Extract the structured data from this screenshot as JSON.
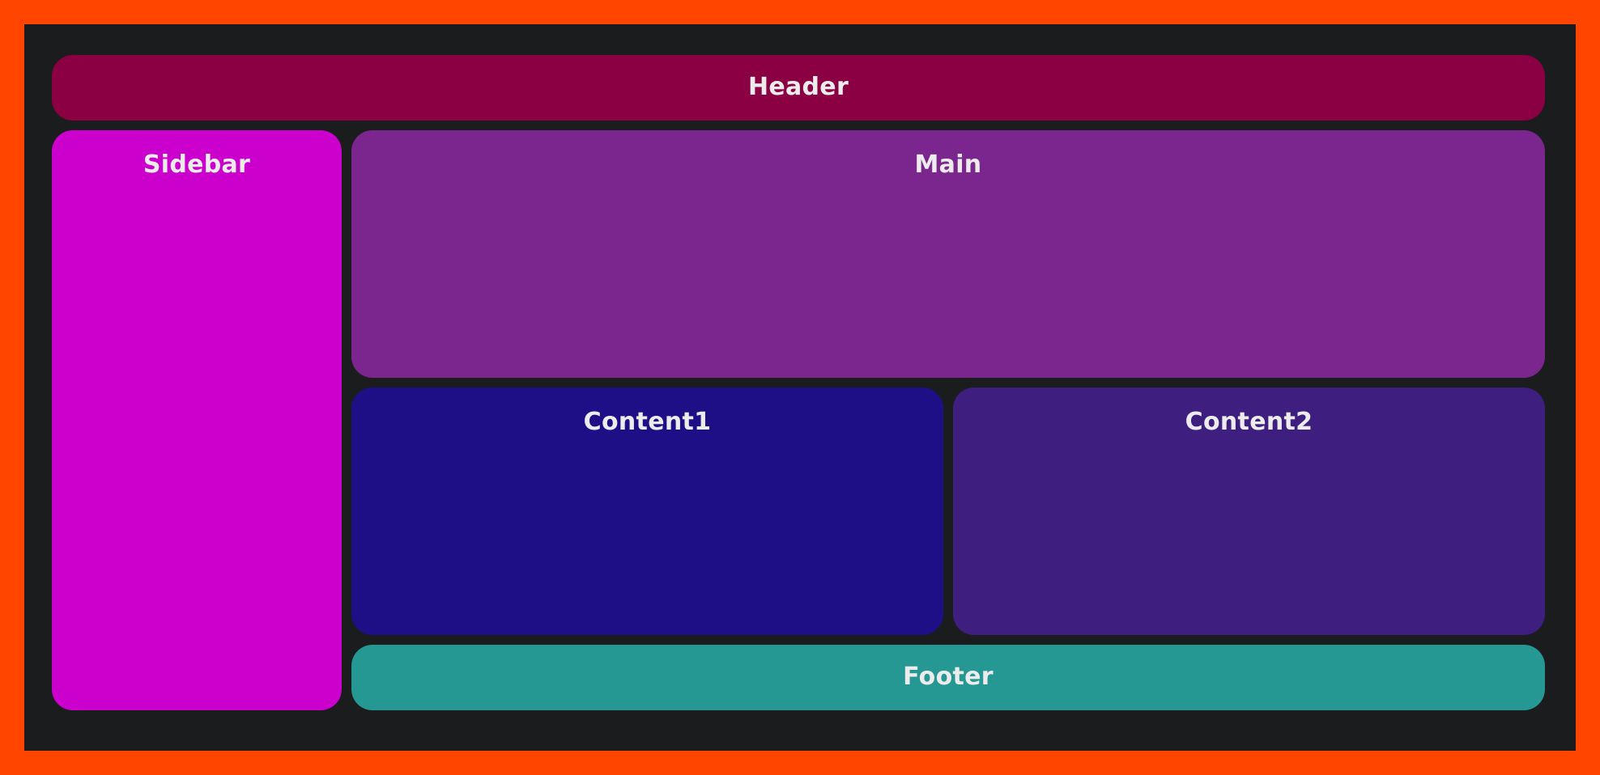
{
  "colors": {
    "outer_border": "#ff4500",
    "canvas_bg": "#1b1c1e",
    "header": "#8b0042",
    "sidebar": "#cc00cc",
    "main": "#7b268f",
    "content1": "#1f0f86",
    "content2": "#3e1f80",
    "footer": "#269894",
    "text": "#ececec"
  },
  "layout": {
    "header": {
      "label": "Header"
    },
    "sidebar": {
      "label": "Sidebar"
    },
    "main": {
      "label": "Main"
    },
    "content1": {
      "label": "Content1"
    },
    "content2": {
      "label": "Content2"
    },
    "footer": {
      "label": "Footer"
    }
  }
}
